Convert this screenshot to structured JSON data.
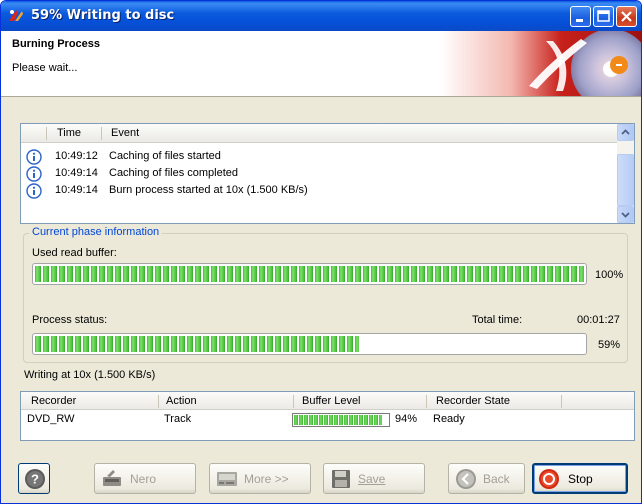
{
  "window": {
    "title": "59% Writing to disc"
  },
  "header": {
    "title": "Burning Process",
    "subtitle": "Please wait..."
  },
  "log": {
    "columns": [
      "Time",
      "Event"
    ],
    "rows": [
      {
        "time": "10:49:12",
        "event": "Caching of files started"
      },
      {
        "time": "10:49:14",
        "event": "Caching of files completed"
      },
      {
        "time": "10:49:14",
        "event": "Burn process started at 10x (1.500 KB/s)"
      }
    ]
  },
  "phase": {
    "legend": "Current phase information",
    "read_buffer_label": "Used read buffer:",
    "read_buffer_percent": "100%",
    "read_buffer_value": 1.0,
    "status_label": "Process status:",
    "total_time_label": "Total time:",
    "total_time": "00:01:27",
    "status_percent": "59%",
    "status_value": 0.59
  },
  "writing_text": "Writing at 10x (1.500 KB/s)",
  "recorders": {
    "columns": [
      "Recorder",
      "Action",
      "Buffer Level",
      "Recorder State"
    ],
    "rows": [
      {
        "recorder": "DVD_RW",
        "action": "Track",
        "buffer_percent": "94%",
        "buffer_value": 0.94,
        "state": "Ready"
      }
    ]
  },
  "buttons": {
    "help": "?",
    "nero": "Nero",
    "more": "More >>",
    "save": "Save",
    "back": "Back",
    "stop": "Stop"
  },
  "colors": {
    "progress": "#46bc38",
    "title_bar": "#0a5ae3",
    "accent_link": "#0046d5"
  }
}
